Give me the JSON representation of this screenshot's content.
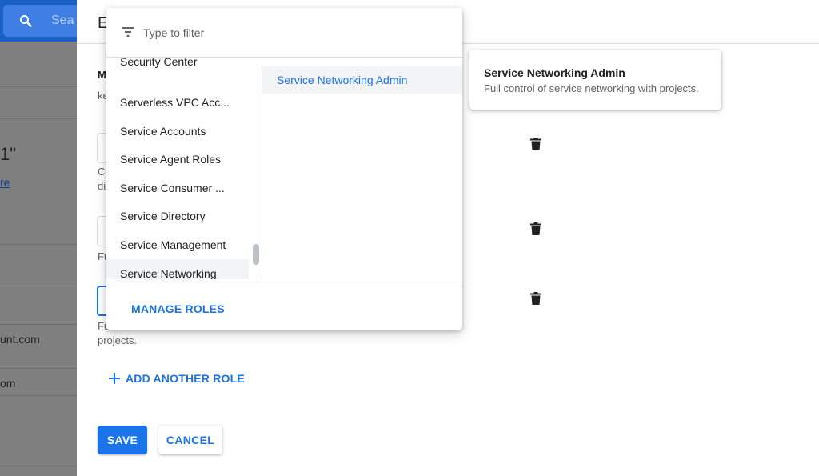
{
  "background": {
    "search_placeholder": "Sea",
    "quote_text": "1\"",
    "link_text": "re",
    "email_1": "unt.com",
    "email_2": "om"
  },
  "panel": {
    "title": "E",
    "member_label": "M",
    "member_value": "ke",
    "role_1_helper_1": "Ca",
    "role_1_helper_2": "di",
    "role_2_helper": "Fu",
    "role_3_helper": "Fu",
    "role_3_helper_2": "projects.",
    "add_role_label": "ADD ANOTHER ROLE",
    "save_label": "SAVE",
    "cancel_label": "CANCEL"
  },
  "picker": {
    "filter_placeholder": "Type to filter",
    "services": [
      "Security Center",
      "Serverless VPC Acc...",
      "Service Accounts",
      "Service Agent Roles",
      "Service Consumer ...",
      "Service Directory",
      "Service Management",
      "Service Networking"
    ],
    "selected_service": "Service Networking",
    "roles": [
      "Service Networking Admin"
    ],
    "manage_roles_label": "MANAGE ROLES"
  },
  "tooltip": {
    "title": "Service Networking Admin",
    "description": "Full control of service networking with projects."
  },
  "colors": {
    "accent": "#1a73e8",
    "scrim": "#7f7f7f"
  }
}
